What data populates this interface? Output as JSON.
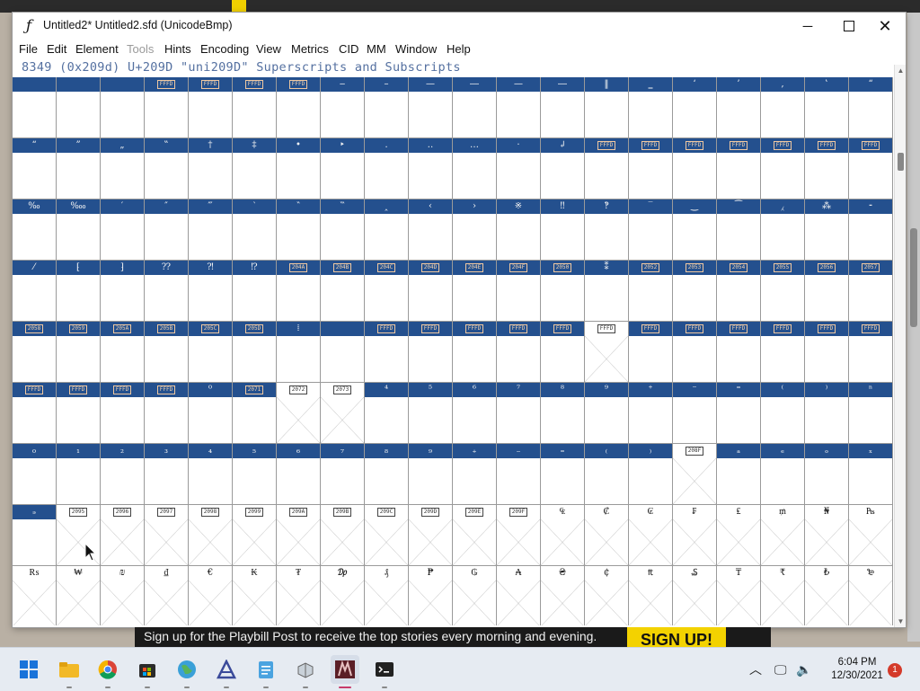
{
  "window": {
    "title": "Untitled2*  Untitled2.sfd (UnicodeBmp)",
    "controls": {
      "minimize": "─",
      "close": "✕"
    }
  },
  "menu": [
    "File",
    "Edit",
    "Element",
    "Tools",
    "Hints",
    "Encoding",
    "View",
    "Metrics",
    "CID",
    "MM",
    "Window",
    "Help"
  ],
  "menu_disabled": [
    "Tools"
  ],
  "info_line": "8349 (0x209d) U+209D \"uni209D\" Superscripts and Subscripts",
  "grid": {
    "rows": [
      {
        "cells": [
          {
            "t": ""
          },
          {
            "t": ""
          },
          {
            "t": ""
          },
          {
            "b": "FFFD"
          },
          {
            "b": "FFFD"
          },
          {
            "b": "FFFD"
          },
          {
            "b": "FFFD"
          },
          {
            "t": "‒"
          },
          {
            "t": "–"
          },
          {
            "t": "—"
          },
          {
            "t": "―"
          },
          {
            "t": "—"
          },
          {
            "t": "―"
          },
          {
            "t": "‖"
          },
          {
            "t": "‗"
          },
          {
            "t": "‘"
          },
          {
            "t": "’"
          },
          {
            "t": "‚"
          },
          {
            "t": "‛"
          },
          {
            "t": "“"
          }
        ]
      },
      {
        "cells": [
          {
            "t": "“"
          },
          {
            "t": "”"
          },
          {
            "t": "„"
          },
          {
            "t": "‟"
          },
          {
            "t": "†"
          },
          {
            "t": "‡"
          },
          {
            "t": "•"
          },
          {
            "t": "‣"
          },
          {
            "t": "․"
          },
          {
            "t": "‥"
          },
          {
            "t": "…"
          },
          {
            "t": "‧"
          },
          {
            "t": "↲"
          },
          {
            "b": "FFFD"
          },
          {
            "b": "FFFD"
          },
          {
            "b": "FFFD"
          },
          {
            "b": "FFFD"
          },
          {
            "b": "FFFD"
          },
          {
            "b": "FFFD"
          },
          {
            "b": "FFFD"
          }
        ]
      },
      {
        "cells": [
          {
            "t": "‰"
          },
          {
            "t": "‱"
          },
          {
            "t": "′"
          },
          {
            "t": "″"
          },
          {
            "t": "‴"
          },
          {
            "t": "‵"
          },
          {
            "t": "‶"
          },
          {
            "t": "‷"
          },
          {
            "t": "‸"
          },
          {
            "t": "‹"
          },
          {
            "t": "›"
          },
          {
            "t": "※"
          },
          {
            "t": "‼"
          },
          {
            "t": "‽"
          },
          {
            "t": "‾"
          },
          {
            "t": "‿"
          },
          {
            "t": "⁀"
          },
          {
            "t": "⁁"
          },
          {
            "t": "⁂"
          },
          {
            "t": "⁃"
          }
        ]
      },
      {
        "cells": [
          {
            "t": "⁄"
          },
          {
            "t": "⁅"
          },
          {
            "t": "⁆"
          },
          {
            "t": "⁇"
          },
          {
            "t": "⁈"
          },
          {
            "t": "⁉"
          },
          {
            "b": "204A"
          },
          {
            "b": "204B"
          },
          {
            "b": "204C"
          },
          {
            "b": "204D"
          },
          {
            "b": "204E"
          },
          {
            "b": "204F"
          },
          {
            "b": "2050"
          },
          {
            "t": "⁑"
          },
          {
            "b": "2052"
          },
          {
            "b": "2053"
          },
          {
            "b": "2054"
          },
          {
            "b": "2055"
          },
          {
            "b": "2056"
          },
          {
            "b": "2057"
          }
        ]
      },
      {
        "cells": [
          {
            "b": "2058"
          },
          {
            "b": "2059"
          },
          {
            "b": "205A"
          },
          {
            "b": "205B"
          },
          {
            "b": "205C"
          },
          {
            "b": "205D"
          },
          {
            "t": "⁞"
          },
          {
            "t": ""
          },
          {
            "b": "FFFD"
          },
          {
            "b": "FFFD"
          },
          {
            "b": "FFFD"
          },
          {
            "b": "FFFD"
          },
          {
            "b": "FFFD"
          },
          {
            "b": "FFFD",
            "sel": true,
            "x": true
          },
          {
            "b": "FFFD"
          },
          {
            "b": "FFFD"
          },
          {
            "b": "FFFD"
          },
          {
            "b": "FFFD"
          },
          {
            "b": "FFFD"
          },
          {
            "b": "FFFD"
          }
        ]
      },
      {
        "cells": [
          {
            "b": "FFFD"
          },
          {
            "b": "FFFD"
          },
          {
            "b": "FFFD"
          },
          {
            "b": "FFFD"
          },
          {
            "t": "⁰"
          },
          {
            "b": "2071"
          },
          {
            "b": "2072",
            "plain": true,
            "x": true
          },
          {
            "b": "2073",
            "plain": true,
            "x": true
          },
          {
            "t": "⁴"
          },
          {
            "t": "⁵"
          },
          {
            "t": "⁶"
          },
          {
            "t": "⁷"
          },
          {
            "t": "⁸"
          },
          {
            "t": "⁹"
          },
          {
            "t": "⁺"
          },
          {
            "t": "⁻"
          },
          {
            "t": "⁼"
          },
          {
            "t": "⁽"
          },
          {
            "t": "⁾"
          },
          {
            "t": "ⁿ"
          }
        ]
      },
      {
        "cells": [
          {
            "t": "₀"
          },
          {
            "t": "₁"
          },
          {
            "t": "₂"
          },
          {
            "t": "₃"
          },
          {
            "t": "₄"
          },
          {
            "t": "₅"
          },
          {
            "t": "₆"
          },
          {
            "t": "₇"
          },
          {
            "t": "₈"
          },
          {
            "t": "₉"
          },
          {
            "t": "₊"
          },
          {
            "t": "₋"
          },
          {
            "t": "₌"
          },
          {
            "t": "₍"
          },
          {
            "t": "₎"
          },
          {
            "b": "208F",
            "plain": true,
            "x": true
          },
          {
            "t": "ₐ"
          },
          {
            "t": "ₑ"
          },
          {
            "t": "ₒ"
          },
          {
            "t": "ₓ"
          }
        ]
      },
      {
        "cells": [
          {
            "t": "ₔ"
          },
          {
            "b": "2095",
            "plain": true,
            "x": true
          },
          {
            "b": "2096",
            "plain": true,
            "x": true
          },
          {
            "b": "2097",
            "plain": true,
            "x": true
          },
          {
            "b": "2098",
            "plain": true,
            "x": true
          },
          {
            "b": "2099",
            "plain": true,
            "x": true
          },
          {
            "b": "209A",
            "plain": true,
            "x": true
          },
          {
            "b": "209B",
            "plain": true,
            "x": true
          },
          {
            "b": "209C",
            "plain": true,
            "x": true
          },
          {
            "b": "209D",
            "plain": true,
            "x": true
          },
          {
            "b": "209E",
            "plain": true,
            "x": true
          },
          {
            "b": "209F",
            "plain": true,
            "x": true
          },
          {
            "t": "₠",
            "plain": true,
            "x": true
          },
          {
            "t": "₡",
            "plain": true,
            "x": true
          },
          {
            "t": "₢",
            "plain": true,
            "x": true
          },
          {
            "t": "₣",
            "plain": true,
            "x": true
          },
          {
            "t": "₤",
            "plain": true,
            "x": true
          },
          {
            "t": "₥",
            "plain": true,
            "x": true
          },
          {
            "t": "₦",
            "plain": true,
            "x": true
          },
          {
            "t": "₧",
            "plain": true,
            "x": true
          }
        ]
      },
      {
        "cells": [
          {
            "t": "₨",
            "plain": true,
            "x": true
          },
          {
            "t": "₩",
            "plain": true,
            "x": true
          },
          {
            "t": "₪",
            "plain": true,
            "x": true
          },
          {
            "t": "₫",
            "plain": true,
            "x": true
          },
          {
            "t": "€",
            "plain": true,
            "x": true
          },
          {
            "t": "₭",
            "plain": true,
            "x": true
          },
          {
            "t": "₮",
            "plain": true,
            "x": true
          },
          {
            "t": "₯",
            "plain": true,
            "x": true
          },
          {
            "t": "₰",
            "plain": true,
            "x": true
          },
          {
            "t": "₱",
            "plain": true,
            "x": true
          },
          {
            "t": "₲",
            "plain": true,
            "x": true
          },
          {
            "t": "₳",
            "plain": true,
            "x": true
          },
          {
            "t": "₴",
            "plain": true,
            "x": true
          },
          {
            "t": "₵",
            "plain": true,
            "x": true
          },
          {
            "t": "₶",
            "plain": true,
            "x": true
          },
          {
            "t": "₷",
            "plain": true,
            "x": true
          },
          {
            "t": "₸",
            "plain": true,
            "x": true
          },
          {
            "t": "₹",
            "plain": true,
            "x": true
          },
          {
            "t": "₺",
            "plain": true,
            "x": true
          },
          {
            "t": "₻",
            "plain": true,
            "x": true
          }
        ]
      }
    ]
  },
  "ad_banner": {
    "text": "Sign up for the Playbill Post to receive the top stories every morning and evening.",
    "button": "SIGN UP!"
  },
  "taskbar": {
    "icons": [
      "windows-start-icon",
      "file-explorer-icon",
      "chrome-icon",
      "microsoft-store-icon",
      "globe-app-icon",
      "font-app-icon",
      "notepad-icon",
      "remote-app-icon",
      "fontforge-icon",
      "terminal-icon"
    ],
    "active": "fontforge-icon",
    "clock_time": "6:04 PM",
    "clock_date": "12/30/2021",
    "notifications": "1"
  },
  "colors": {
    "label_bar": "#24508e",
    "accent_active": "#c83c6c"
  }
}
